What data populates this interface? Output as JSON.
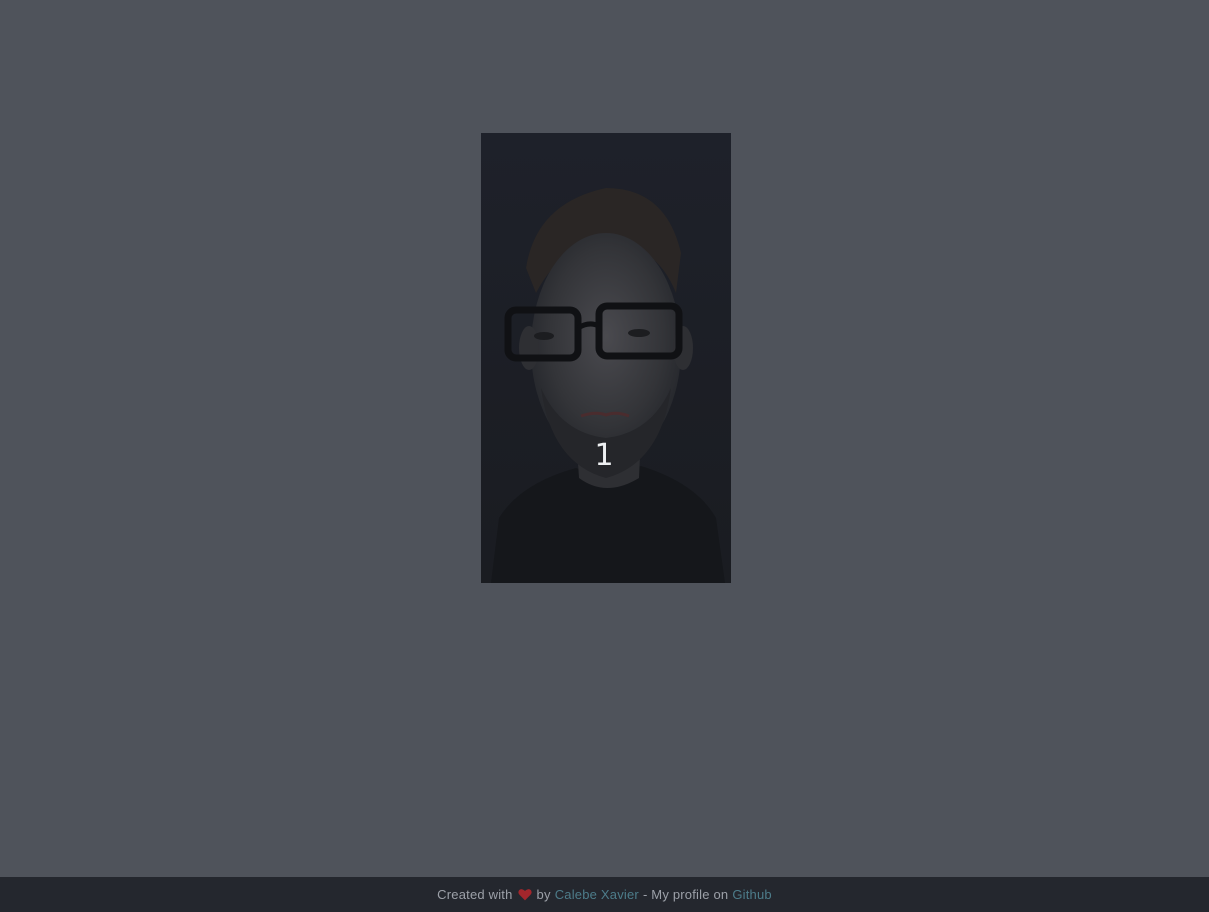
{
  "card": {
    "counter": "1",
    "image_alt": "Portrait photo of a man with glasses"
  },
  "footer": {
    "created_with": "Created with",
    "by": "by",
    "author": "Calebe Xavier",
    "separator": "- My profile on",
    "github": "Github"
  },
  "colors": {
    "background": "#4f535b",
    "footer_background": "#24272e",
    "link": "#4d7c8a",
    "heart": "#a3262c"
  },
  "icons": {
    "heart": "heart-icon"
  }
}
